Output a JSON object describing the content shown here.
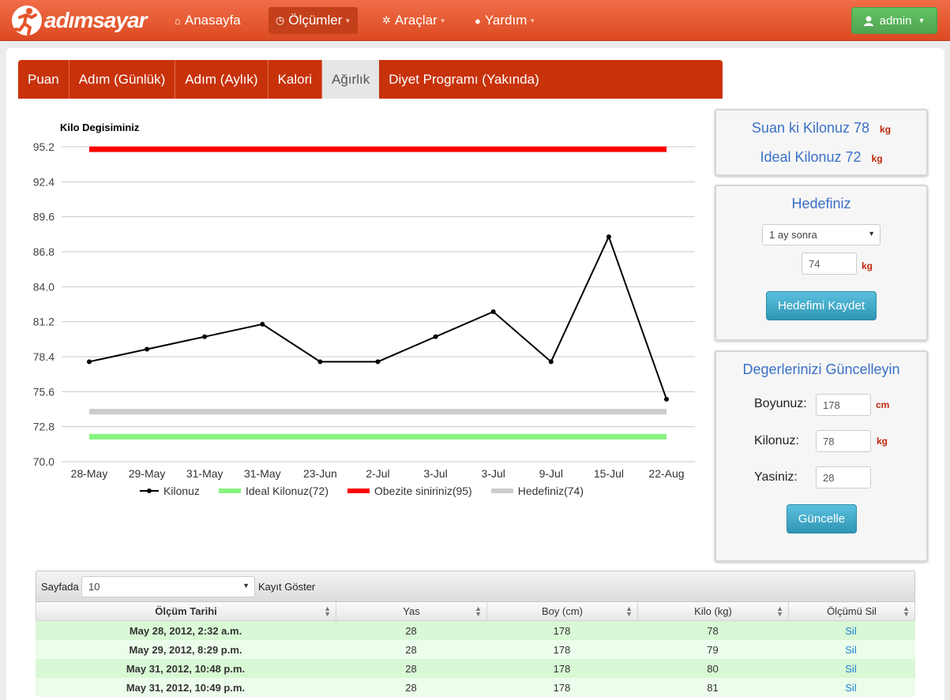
{
  "brand": {
    "name": "adımsayar"
  },
  "nav": {
    "items": [
      {
        "label": "Anasayfa",
        "icon": "home-icon",
        "glyph": "⌂",
        "caret": false,
        "active": false
      },
      {
        "label": "Ölçümler",
        "icon": "clock-icon",
        "glyph": "◷",
        "caret": true,
        "active": true
      },
      {
        "label": "Araçlar",
        "icon": "gear-icon",
        "glyph": "✲",
        "caret": true,
        "active": false
      },
      {
        "label": "Yardım",
        "icon": "user-icon",
        "glyph": "●",
        "caret": true,
        "active": false
      }
    ],
    "user_label": "admin"
  },
  "tabs": [
    {
      "label": "Puan",
      "active": false
    },
    {
      "label": "Adım (Günlük)",
      "active": false
    },
    {
      "label": "Adım (Aylık)",
      "active": false
    },
    {
      "label": "Kalori",
      "active": false
    },
    {
      "label": "Ağırlık",
      "active": true
    },
    {
      "label": "Diyet Programı (Yakında)",
      "active": false
    }
  ],
  "chart_data": {
    "type": "line",
    "title": "Kilo Degisiminiz",
    "categories": [
      "28-May",
      "29-May",
      "31-May",
      "31-May",
      "23-Jun",
      "2-Jul",
      "3-Jul",
      "3-Jul",
      "9-Jul",
      "15-Jul",
      "22-Aug"
    ],
    "y_ticks": [
      "95.2",
      "92.4",
      "89.6",
      "86.8",
      "84.0",
      "81.2",
      "78.4",
      "75.6",
      "72.8",
      "70.0"
    ],
    "ylim": [
      70.0,
      95.2
    ],
    "grid": true,
    "legend_position": "bottom",
    "series": [
      {
        "name": "Kilonuz",
        "color": "#000000",
        "kind": "line-markers",
        "values": [
          78,
          79,
          80,
          81,
          78,
          78,
          80,
          82,
          78,
          88,
          75
        ]
      },
      {
        "name": "Ideal Kilonuz(72)",
        "color": "#88f27e",
        "kind": "band",
        "values": [
          72,
          72,
          72,
          72,
          72,
          72,
          72,
          72,
          72,
          72,
          72
        ]
      },
      {
        "name": "Obezite siniriniz(95)",
        "color": "#ff0000",
        "kind": "band",
        "values": [
          95,
          95,
          95,
          95,
          95,
          95,
          95,
          95,
          95,
          95,
          95
        ]
      },
      {
        "name": "Hedefiniz(74)",
        "color": "#cccccc",
        "kind": "band",
        "values": [
          74,
          74,
          74,
          74,
          74,
          74,
          74,
          74,
          74,
          74,
          74
        ]
      }
    ]
  },
  "current": {
    "current_text": "Suan ki Kilonuz 78",
    "ideal_text": "Ideal Kilonuz 72",
    "unit": "kg"
  },
  "goal": {
    "title": "Hedefiniz",
    "period_select": "1 ay sonra",
    "target_value": "74",
    "unit": "kg",
    "save_label": "Hedefimi Kaydet"
  },
  "update": {
    "title": "Degerlerinizi Güncelleyin",
    "height_label": "Boyunuz:",
    "height_value": "178",
    "height_unit": "cm",
    "weight_label": "Kilonuz:",
    "weight_value": "78",
    "weight_unit": "kg",
    "age_label": "Yasiniz:",
    "age_value": "28",
    "submit_label": "Güncelle"
  },
  "table": {
    "page_size_label": "Sayfada",
    "page_size_value": "10",
    "show_label": "Kayıt Göster",
    "columns": [
      "Ölçüm Tarihi",
      "Yas",
      "Boy (cm)",
      "Kilo (kg)",
      "Ölçümü Sil"
    ],
    "rows": [
      {
        "date": "May 28, 2012, 2:32 a.m.",
        "age": "28",
        "height": "178",
        "weight": "78",
        "action": "Sil"
      },
      {
        "date": "May 29, 2012, 8:29 p.m.",
        "age": "28",
        "height": "178",
        "weight": "79",
        "action": "Sil"
      },
      {
        "date": "May 31, 2012, 10:48 p.m.",
        "age": "28",
        "height": "178",
        "weight": "80",
        "action": "Sil"
      },
      {
        "date": "May 31, 2012, 10:49 p.m.",
        "age": "28",
        "height": "178",
        "weight": "81",
        "action": "Sil"
      }
    ]
  }
}
